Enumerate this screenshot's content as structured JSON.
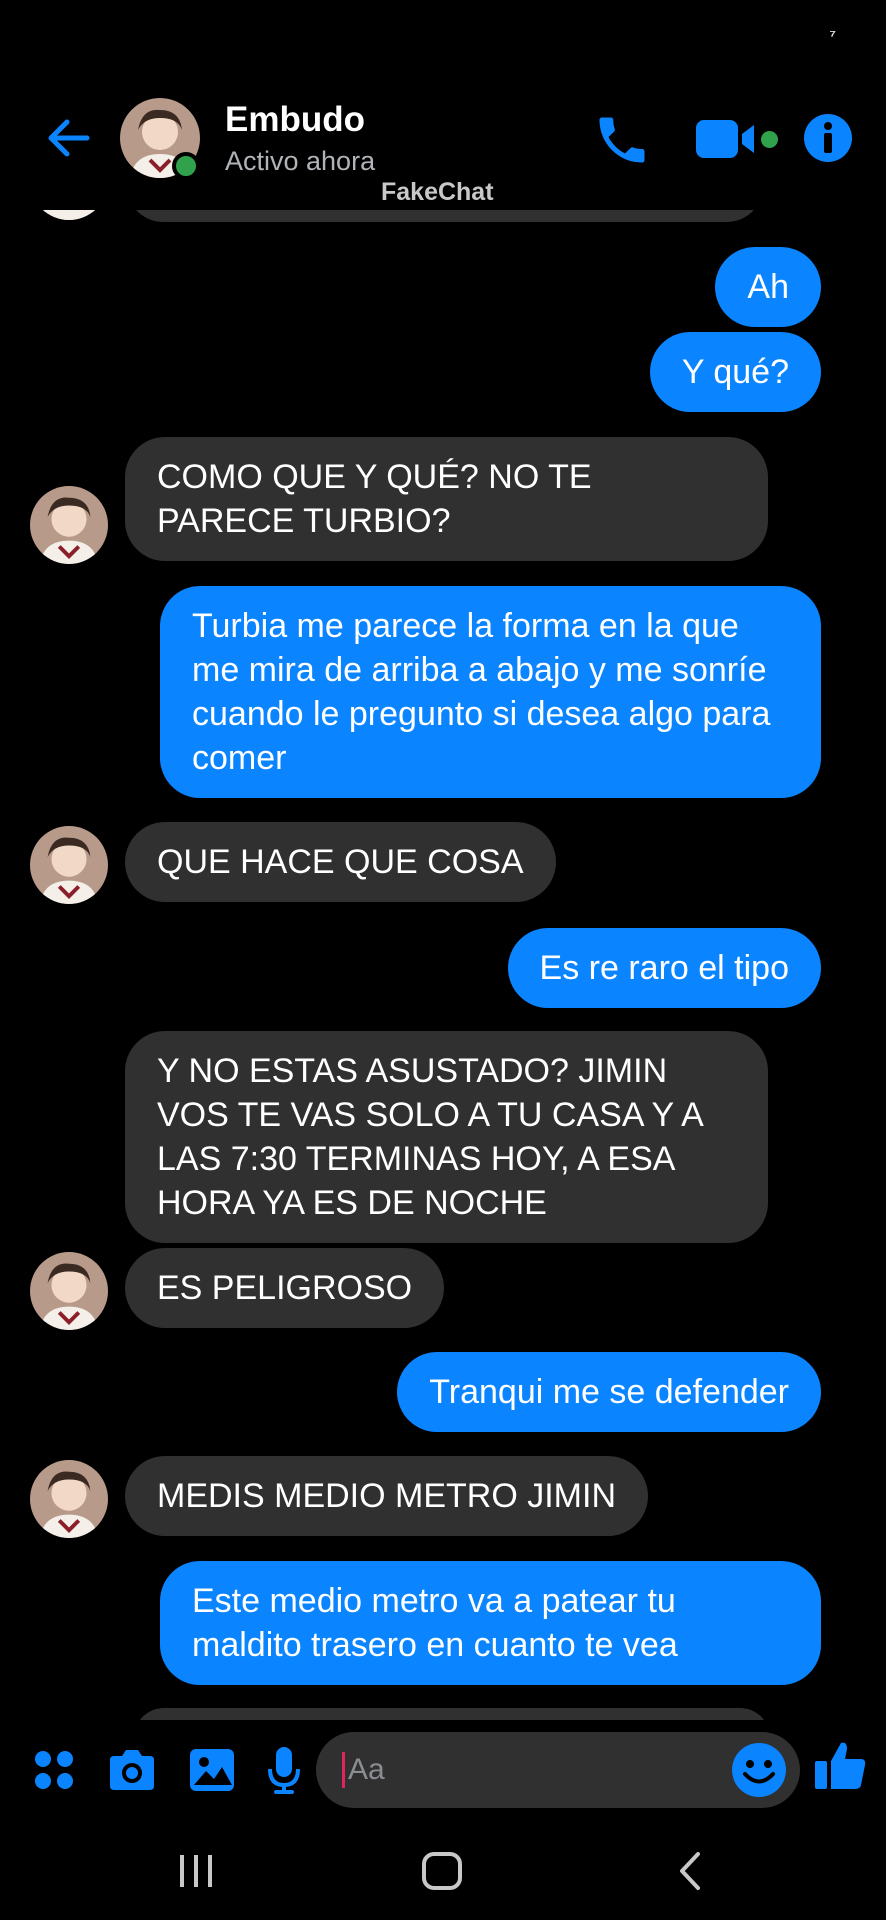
{
  "status_bar": {
    "glyph": "⁷"
  },
  "header": {
    "contact_name": "Embudo",
    "contact_status": "Activo ahora",
    "watermark": "FakeChat",
    "icons": [
      "back-arrow-icon",
      "phone-icon",
      "video-camera-icon",
      "info-icon"
    ]
  },
  "messages": [
    {
      "dir": "out",
      "text": "Ah"
    },
    {
      "dir": "out",
      "text": "Y qué?"
    },
    {
      "dir": "in",
      "text": "COMO QUE Y QUÉ? NO TE PARECE TURBIO?"
    },
    {
      "dir": "out",
      "text": "Turbia me parece la forma en la que me mira de arriba a abajo y me sonríe cuando le pregunto si desea algo para comer"
    },
    {
      "dir": "in",
      "text": "QUE HACE QUE COSA"
    },
    {
      "dir": "out",
      "text": "Es re raro el tipo"
    },
    {
      "dir": "in",
      "text": "Y NO ESTAS ASUSTADO? JIMIN VOS TE VAS SOLO A TU CASA Y A LAS 7:30 TERMINAS HOY, A ESA HORA YA ES DE NOCHE"
    },
    {
      "dir": "in",
      "text": "ES PELIGROSO"
    },
    {
      "dir": "out",
      "text": "Tranqui me se defender"
    },
    {
      "dir": "in",
      "text": "MEDIS MEDIO METRO JIMIN"
    },
    {
      "dir": "out",
      "text": "Este medio metro va a patear tu maldito trasero en cuanto te vea"
    }
  ],
  "composer": {
    "placeholder": "Aa",
    "icons": [
      "apps-grid-icon",
      "camera-icon",
      "gallery-icon",
      "microphone-icon",
      "emoji-icon",
      "thumbs-up-icon"
    ]
  },
  "nav_bar": {
    "icons": [
      "recent-apps-icon",
      "home-icon",
      "back-icon"
    ]
  },
  "colors": {
    "accent": "#0a84ff",
    "incoming_bubble": "#303030",
    "online": "#31a24c",
    "background": "#000000"
  }
}
